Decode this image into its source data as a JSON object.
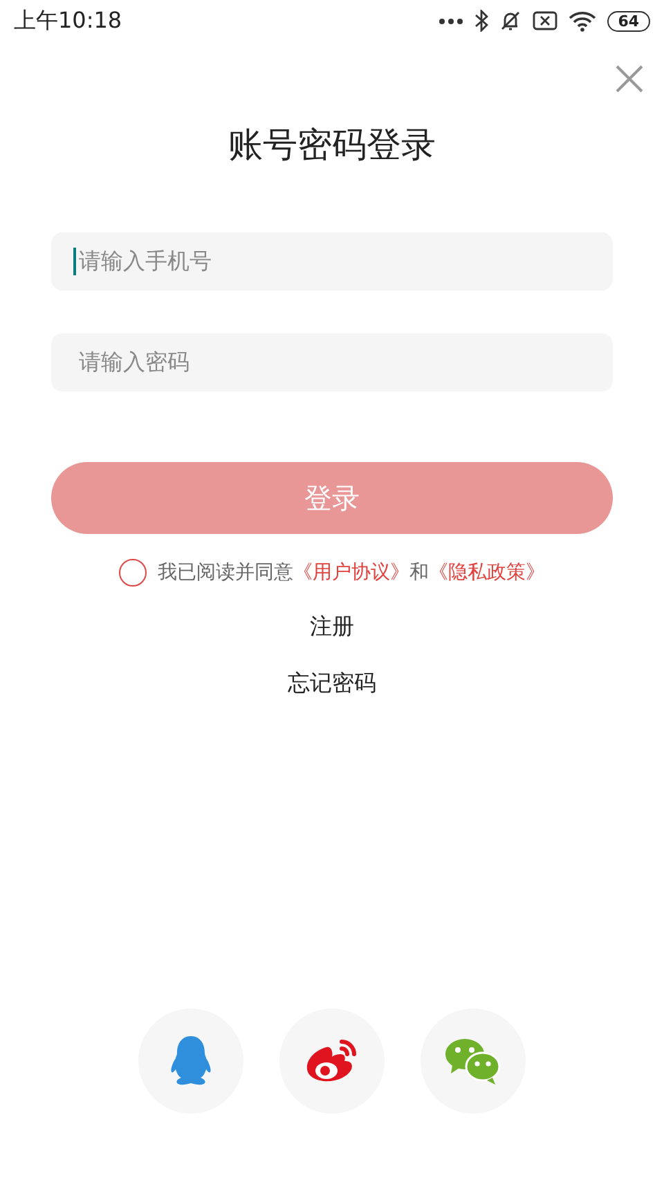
{
  "status_bar": {
    "time": "上午10:18",
    "battery": "64"
  },
  "title": "账号密码登录",
  "fields": [
    {
      "placeholder": "请输入手机号",
      "focused": true
    },
    {
      "placeholder": "请输入密码",
      "focused": false
    }
  ],
  "login_button": "登录",
  "agreement": {
    "checked": false,
    "parts": [
      {
        "kind": "text",
        "text": "我已阅读并同意"
      },
      {
        "kind": "link",
        "text": "《用户协议》"
      },
      {
        "kind": "text",
        "text": "和"
      },
      {
        "kind": "link",
        "text": "《隐私政策》"
      }
    ]
  },
  "links": [
    "注册",
    "忘记密码"
  ],
  "social": [
    {
      "kind": "qq"
    },
    {
      "kind": "weibo"
    },
    {
      "kind": "wechat"
    }
  ]
}
